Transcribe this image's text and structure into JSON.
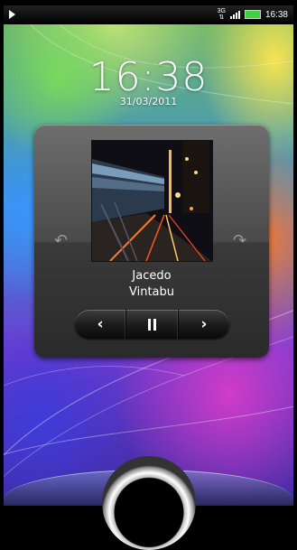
{
  "status_bar": {
    "network_type": "3G",
    "time": "16:38",
    "icons": [
      "play-icon",
      "network-3g-icon",
      "signal-icon",
      "battery-icon"
    ]
  },
  "lockscreen": {
    "clock": "16:38",
    "date": "31/03/2011"
  },
  "music_widget": {
    "track_title": "Jacedo",
    "artist": "Vintabu",
    "album_art": "city-night-traffic",
    "prev_label": "‹",
    "next_label": "›",
    "left_side_icon": "previous-track-curl-icon",
    "right_side_icon": "next-track-curl-icon"
  },
  "unlock": {
    "ring_icon": "unlock-ring-icon"
  },
  "colors": {
    "battery": "#3fd13f",
    "widget_bg": "#3a3a3a",
    "text": "#ffffff"
  }
}
